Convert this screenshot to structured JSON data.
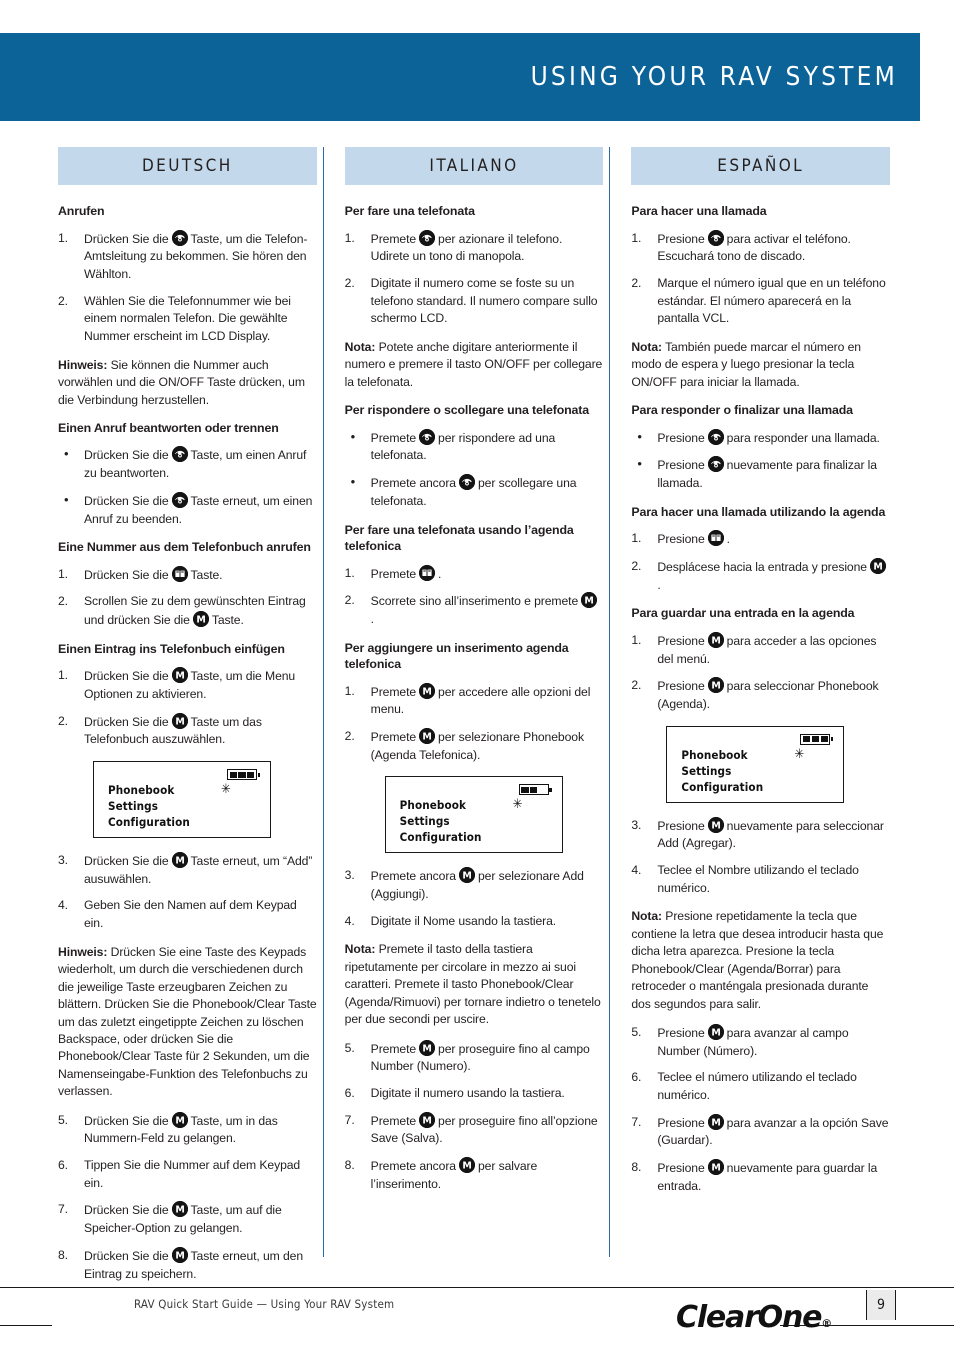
{
  "header": {
    "title": "USING YOUR RAV SYSTEM",
    "bar_color": "#0b6398",
    "lang_header_color": "#c3d8ea"
  },
  "columns": [
    {
      "lang": "DEUTSCH",
      "blocks": [
        {
          "kind": "h3",
          "text": "Anrufen"
        },
        {
          "kind": "ol",
          "items": [
            {
              "pre": "Drücken Sie die",
              "icon": "phone-icon",
              "post": "Taste, um die Telefon-Amtsleitung zu bekommen. Sie hören den Wählton."
            },
            {
              "pre": "Wählen Sie die Telefonnummer wie bei einem normalen Telefon. Die gewählte Nummer erscheint im LCD Display.",
              "icon": null,
              "post": ""
            }
          ]
        },
        {
          "kind": "note",
          "lead": "Hinweis:",
          "text": " Sie können die Nummer auch vorwählen und die ON/OFF Taste drücken, um die Verbindung herzustellen."
        },
        {
          "kind": "h3",
          "text": "Einen Anruf beantworten oder trennen"
        },
        {
          "kind": "ul",
          "items": [
            {
              "pre": "Drücken Sie die",
              "icon": "phone-icon",
              "post": "Taste, um einen Anruf zu beantworten."
            },
            {
              "pre": "Drücken Sie die",
              "icon": "phone-icon",
              "post": "Taste erneut, um einen Anruf zu beenden."
            }
          ]
        },
        {
          "kind": "h3",
          "text": "Eine Nummer aus dem Telefonbuch anrufen"
        },
        {
          "kind": "ol-tall",
          "items": [
            {
              "pre": "Drücken Sie die",
              "icon": "phonebook-icon",
              "post": "Taste."
            },
            {
              "pre": "Scrollen Sie zu dem gewünschten Eintrag und drücken Sie die",
              "icon": "menu-icon",
              "post": "Taste."
            }
          ]
        },
        {
          "kind": "h3",
          "text": "Einen Eintrag ins Telefonbuch einfügen"
        },
        {
          "kind": "ol",
          "items": [
            {
              "pre": "Drücken Sie die",
              "icon": "menu-icon",
              "post": "Taste, um die Menu Optionen zu aktivieren."
            },
            {
              "pre": "Drücken Sie die",
              "icon": "menu-icon",
              "post": "Taste um das Telefonbuch auszuwählen."
            }
          ]
        },
        {
          "kind": "lcd"
        },
        {
          "kind": "ol",
          "start": 3,
          "items": [
            {
              "pre": "Drücken Sie die",
              "icon": "menu-icon",
              "post": "Taste erneut, um “Add” ausuwählen."
            },
            {
              "pre": "Geben Sie den Namen auf dem Keypad ein.",
              "icon": null,
              "post": ""
            }
          ]
        },
        {
          "kind": "note",
          "lead": "Hinweis:",
          "text": " Drücken Sie eine Taste des Keypads wiederholt, um durch die verschiedenen durch die jeweilige Taste erzeugbaren Zeichen zu blättern. Drücken Sie die Phonebook/Clear Taste um das zuletzt eingetippte Zeichen zu löschen Backspace, oder drücken Sie die Phonebook/Clear Taste für 2 Sekunden, um die Namenseingabe-Funktion des Telefonbuchs zu verlassen."
        },
        {
          "kind": "ol",
          "start": 5,
          "items": [
            {
              "pre": "Drücken Sie die",
              "icon": "menu-icon",
              "post": "Taste, um in das Nummern-Feld zu gelangen."
            },
            {
              "pre": "Tippen Sie die Nummer auf dem Keypad ein.",
              "icon": null,
              "post": ""
            },
            {
              "pre": "Drücken Sie die",
              "icon": "menu-icon",
              "post": "Taste, um auf die Speicher-Option zu gelangen."
            },
            {
              "pre": "Drücken Sie die",
              "icon": "menu-icon",
              "post": "Taste erneut, um den Eintrag zu speichern."
            }
          ]
        }
      ]
    },
    {
      "lang": "ITALIANO",
      "blocks": [
        {
          "kind": "h3",
          "text": "Per fare una telefonata"
        },
        {
          "kind": "ol",
          "items": [
            {
              "pre": "Premete",
              "icon": "phone-icon",
              "post": "per azionare il telefono. Udirete un tono di manopola."
            },
            {
              "pre": "Digitate il numero come se foste su un telefono standard. Il numero compare sullo schermo LCD.",
              "icon": null,
              "post": ""
            }
          ]
        },
        {
          "kind": "note",
          "lead": "Nota:",
          "text": " Potete anche digitare anteriormente il numero e premere il tasto ON/OFF per collegare la telefonata."
        },
        {
          "kind": "h3",
          "text": "Per rispondere o scollegare una telefonata"
        },
        {
          "kind": "ul",
          "items": [
            {
              "pre": "Premete",
              "icon": "phone-icon",
              "post": "per rispondere ad una telefonata."
            },
            {
              "pre": "Premete ancora",
              "icon": "phone-icon",
              "post": "per scollegare una telefonata."
            }
          ]
        },
        {
          "kind": "h3",
          "text": "Per fare una telefonata usando l’agenda telefonica"
        },
        {
          "kind": "ol-tall",
          "items": [
            {
              "pre": "Premete",
              "icon": "phonebook-icon",
              "post": "."
            },
            {
              "pre": "Scorrete sino all’inserimento e premete",
              "icon": "menu-icon",
              "post": "."
            }
          ]
        },
        {
          "kind": "h3",
          "text": "Per aggiungere un inserimento agenda telefonica"
        },
        {
          "kind": "ol",
          "items": [
            {
              "pre": "Premete",
              "icon": "menu-icon",
              "post": "per accedere alle opzioni del menu."
            },
            {
              "pre": "Premete",
              "icon": "menu-icon",
              "post": "per selezionare Phonebook (Agenda Telefonica)."
            }
          ]
        },
        {
          "kind": "lcd"
        },
        {
          "kind": "ol",
          "start": 3,
          "items": [
            {
              "pre": "Premete ancora",
              "icon": "menu-icon",
              "post": "per selezionare Add (Aggiungi)."
            },
            {
              "pre": "Digitate il Nome usando la tastiera.",
              "icon": null,
              "post": ""
            }
          ]
        },
        {
          "kind": "note",
          "lead": "Nota:",
          "text": " Premete il tasto della tastiera ripetutamente per circolare in mezzo ai suoi caratteri. Premete il tasto Phonebook/Clear (Agenda/Rimuovi) per tornare indietro o tenetelo per due secondi per uscire."
        },
        {
          "kind": "ol",
          "start": 5,
          "items": [
            {
              "pre": "Premete",
              "icon": "menu-icon",
              "post": "per proseguire fino al campo Number (Numero)."
            },
            {
              "pre": "Digitate il numero usando la tastiera.",
              "icon": null,
              "post": ""
            },
            {
              "pre": "Premete",
              "icon": "menu-icon",
              "post": "per proseguire fino all’opzione Save (Salva)."
            },
            {
              "pre": "Premete ancora",
              "icon": "menu-icon",
              "post": "per salvare l’inserimento."
            }
          ]
        }
      ]
    },
    {
      "lang": "ESPAÑOL",
      "blocks": [
        {
          "kind": "h3",
          "text": "Para hacer una llamada"
        },
        {
          "kind": "ol",
          "items": [
            {
              "pre": "Presione",
              "icon": "phone-icon",
              "post": "para activar el teléfono. Escuchará tono de discado."
            },
            {
              "pre": "Marque el número igual que en un teléfono estándar. El número aparecerá en la pantalla VCL.",
              "icon": null,
              "post": ""
            }
          ]
        },
        {
          "kind": "note",
          "lead": "Nota:",
          "text": " También puede marcar el número en modo de espera y luego presionar la tecla ON/OFF para iniciar la llamada."
        },
        {
          "kind": "h3",
          "text": "Para responder o finalizar una llamada"
        },
        {
          "kind": "ul",
          "items": [
            {
              "pre": "Presione",
              "icon": "phone-icon",
              "post": "para responder una llamada."
            },
            {
              "pre": "Presione",
              "icon": "phone-icon",
              "post": "nuevamente para finalizar la llamada."
            }
          ]
        },
        {
          "kind": "h3",
          "text": "Para hacer una llamada utilizando la agenda"
        },
        {
          "kind": "ol-tall",
          "items": [
            {
              "pre": "Presione",
              "icon": "phonebook-icon",
              "post": "."
            },
            {
              "pre": "Desplácese hacia la entrada y presione",
              "icon": "menu-icon",
              "post": "."
            }
          ]
        },
        {
          "kind": "h3",
          "text": "Para guardar una entrada en la agenda"
        },
        {
          "kind": "ol",
          "items": [
            {
              "pre": "Presione",
              "icon": "menu-icon",
              "post": "para acceder a las opciones del menú."
            },
            {
              "pre": "Presione",
              "icon": "menu-icon",
              "post": "para seleccionar Phonebook (Agenda)."
            }
          ]
        },
        {
          "kind": "lcd"
        },
        {
          "kind": "ol",
          "start": 3,
          "items": [
            {
              "pre": "Presione",
              "icon": "menu-icon",
              "post": "nuevamente para seleccionar Add (Agregar)."
            },
            {
              "pre": "Teclee el Nombre utilizando el teclado numérico.",
              "icon": null,
              "post": ""
            }
          ]
        },
        {
          "kind": "note",
          "lead": "Nota:",
          "text": " Presione repetidamente la tecla que contiene la letra que desea introducir hasta que dicha letra aparezca. Presione la tecla Phonebook/Clear (Agenda/Borrar) para retroceder o manténgala presionada durante dos segundos para salir."
        },
        {
          "kind": "ol",
          "start": 5,
          "items": [
            {
              "pre": "Presione",
              "icon": "menu-icon",
              "post": "para avanzar al campo Number (Número)."
            },
            {
              "pre": "Teclee el número utilizando el teclado numérico.",
              "icon": null,
              "post": ""
            },
            {
              "pre": "Presione",
              "icon": "menu-icon",
              "post": "para avanzar a la opción Save (Guardar)."
            },
            {
              "pre": "Presione",
              "icon": "menu-icon",
              "post": "nuevamente para guardar la entrada."
            }
          ]
        }
      ]
    }
  ],
  "lcd_screens": {
    "deutsch": {
      "lines": [
        "Phonebook",
        "Settings",
        "Configuration"
      ],
      "star": "✳",
      "battery_level": 3
    },
    "italiano": {
      "lines": [
        "Phonebook",
        "Settings",
        "Configuration"
      ],
      "star": "✳",
      "battery_level": 2
    },
    "espanol": {
      "lines": [
        "Phonebook",
        "Settings",
        "Configuration"
      ],
      "star": "✳",
      "battery_level": 3
    }
  },
  "footer": {
    "text": "RAV Quick Start Guide — Using Your RAV System",
    "page_number": "9",
    "logo": "ClearOne",
    "logo_mark": "®"
  }
}
